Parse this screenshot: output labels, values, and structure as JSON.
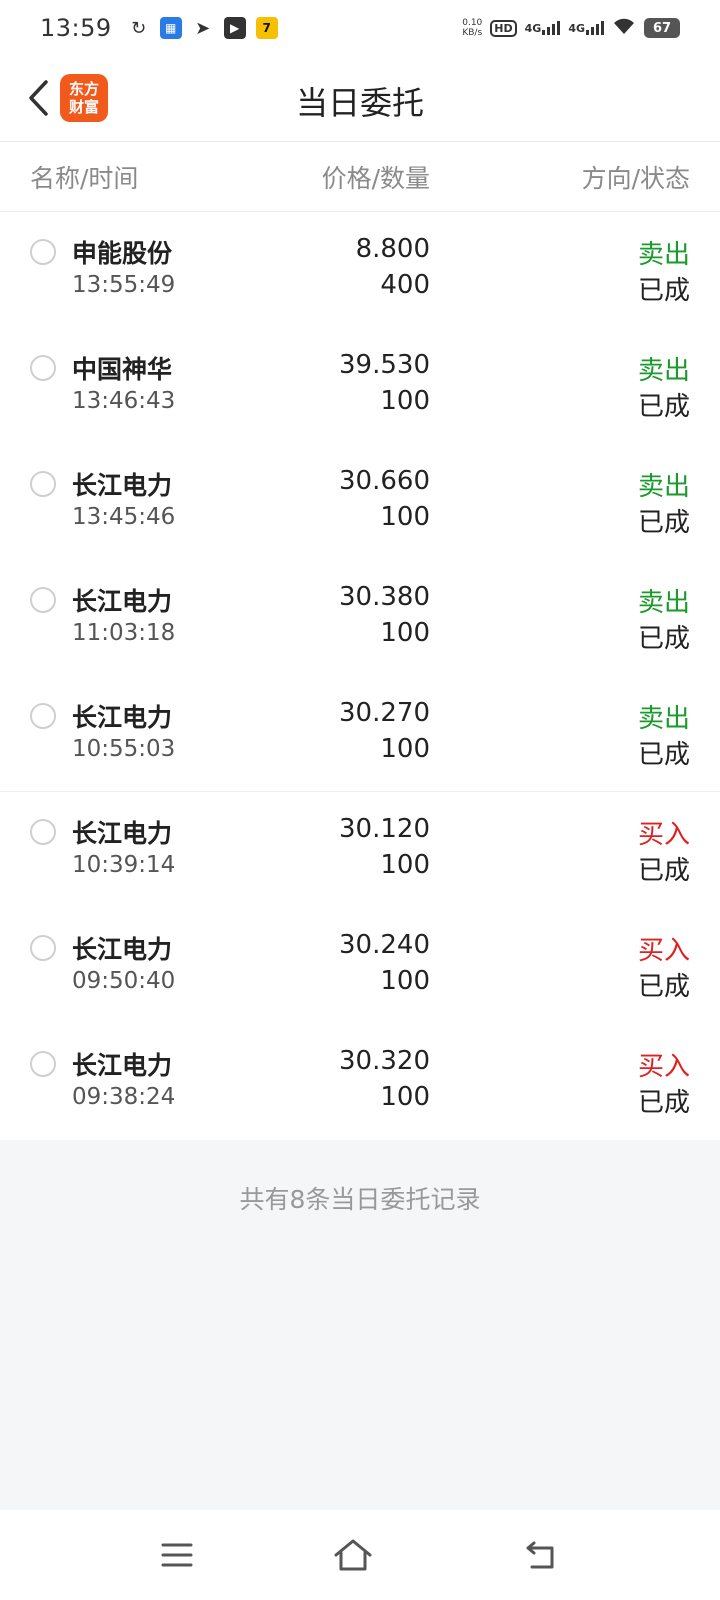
{
  "status_bar": {
    "time": "13:59",
    "speed_value": "0.10",
    "speed_unit": "KB/s",
    "hd_label": "HD",
    "signal1_label": "4G",
    "signal2_label": "4G",
    "battery": "67"
  },
  "header": {
    "title": "当日委托",
    "logo_line1": "东方",
    "logo_line2": "财富"
  },
  "columns": {
    "name_time": "名称/时间",
    "price_qty": "价格/数量",
    "direction_status": "方向/状态"
  },
  "colors": {
    "sell": "#1a9a2a",
    "buy": "#e02020"
  },
  "orders": [
    {
      "name": "申能股份",
      "time": "13:55:49",
      "price": "8.800",
      "qty": "400",
      "direction": "卖出",
      "status": "已成"
    },
    {
      "name": "中国神华",
      "time": "13:46:43",
      "price": "39.530",
      "qty": "100",
      "direction": "卖出",
      "status": "已成"
    },
    {
      "name": "长江电力",
      "time": "13:45:46",
      "price": "30.660",
      "qty": "100",
      "direction": "卖出",
      "status": "已成"
    },
    {
      "name": "长江电力",
      "time": "11:03:18",
      "price": "30.380",
      "qty": "100",
      "direction": "卖出",
      "status": "已成"
    },
    {
      "name": "长江电力",
      "time": "10:55:03",
      "price": "30.270",
      "qty": "100",
      "direction": "卖出",
      "status": "已成"
    },
    {
      "name": "长江电力",
      "time": "10:39:14",
      "price": "30.120",
      "qty": "100",
      "direction": "买入",
      "status": "已成"
    },
    {
      "name": "长江电力",
      "time": "09:50:40",
      "price": "30.240",
      "qty": "100",
      "direction": "买入",
      "status": "已成"
    },
    {
      "name": "长江电力",
      "time": "09:38:24",
      "price": "30.320",
      "qty": "100",
      "direction": "买入",
      "status": "已成"
    }
  ],
  "footer": {
    "summary": "共有8条当日委托记录"
  }
}
